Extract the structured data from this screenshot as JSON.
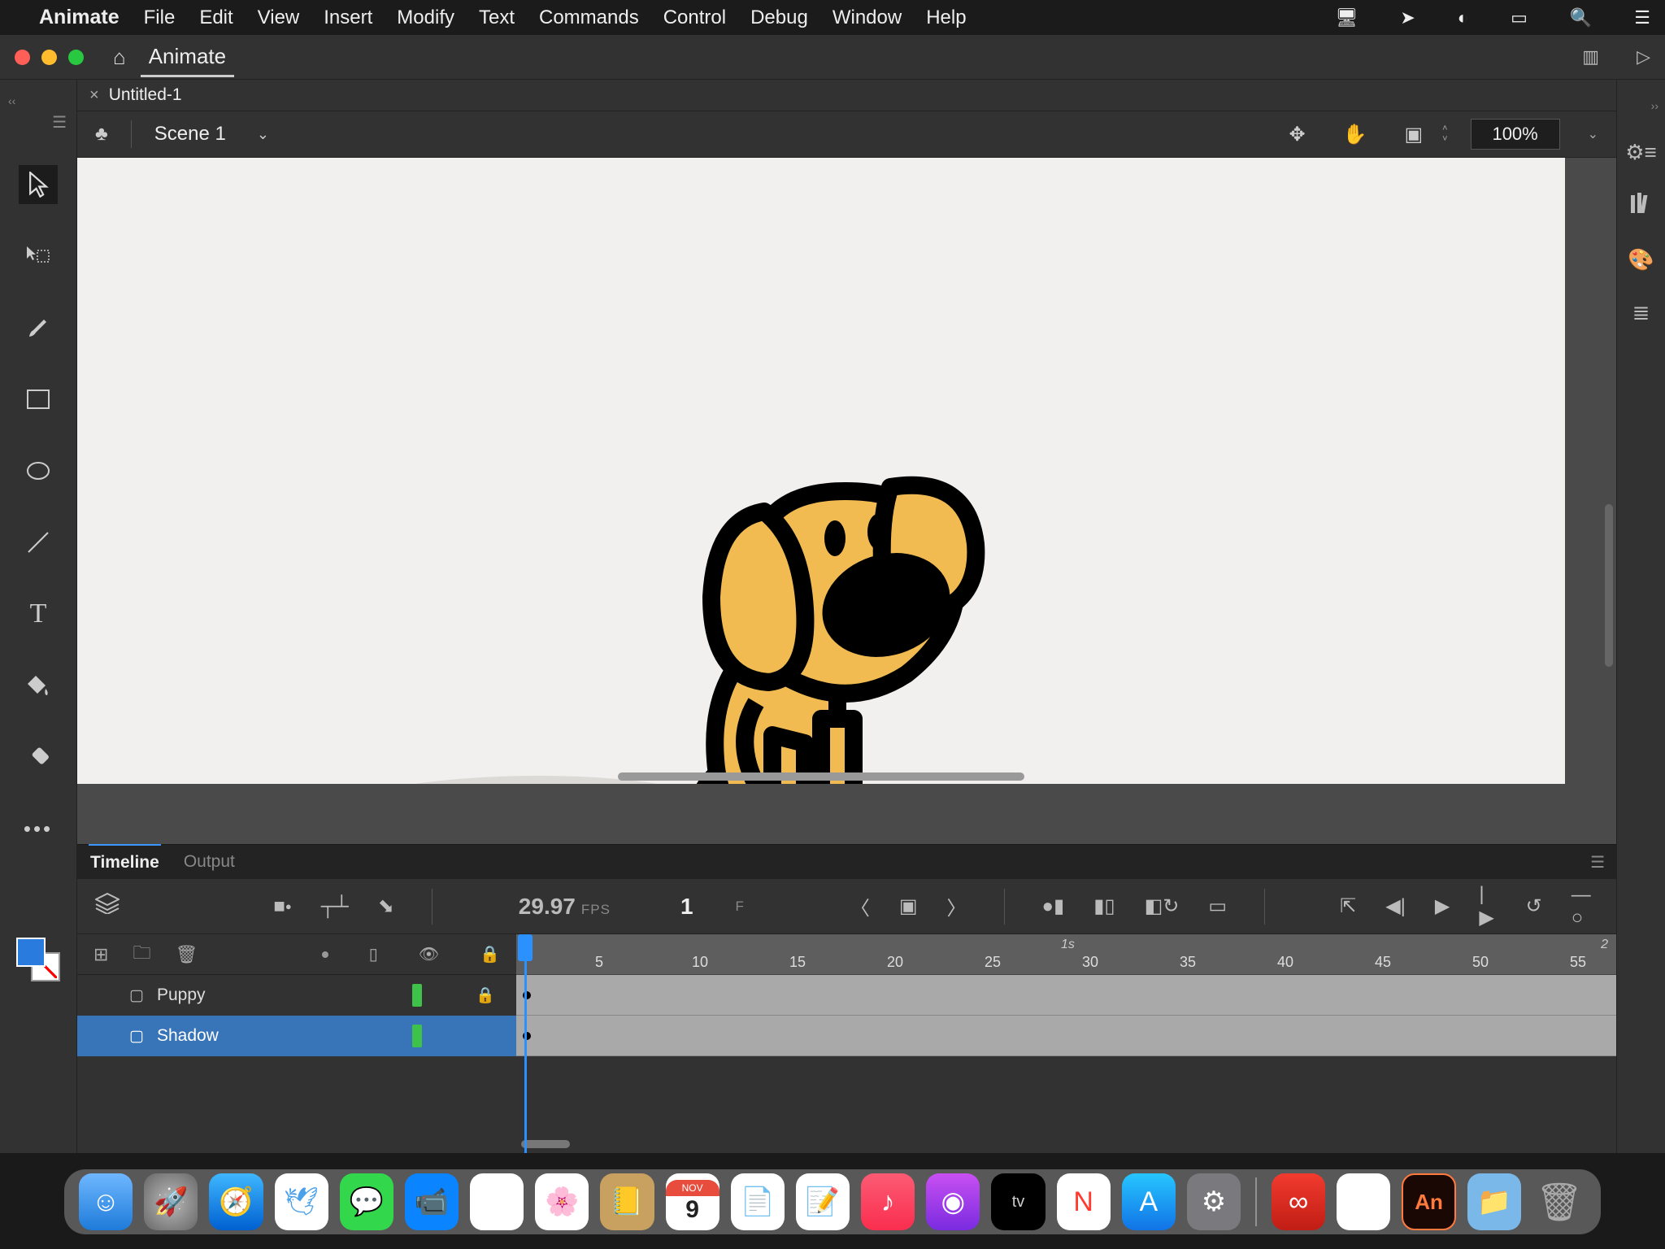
{
  "menubar": {
    "app_name": "Animate",
    "items": [
      "File",
      "Edit",
      "View",
      "Insert",
      "Modify",
      "Text",
      "Commands",
      "Control",
      "Debug",
      "Window",
      "Help"
    ]
  },
  "titlebar": {
    "mode": "Animate"
  },
  "doc_tab": {
    "label": "Untitled-1"
  },
  "editbar": {
    "scene": "Scene 1",
    "zoom": "100%"
  },
  "timeline": {
    "tabs": [
      "Timeline",
      "Output"
    ],
    "active_tab": 0,
    "fps_value": "29.97",
    "fps_unit": "FPS",
    "frame": "1",
    "frame_unit": "F",
    "ruler_time": "1s",
    "ruler_ticks": [
      "5",
      "10",
      "15",
      "20",
      "25",
      "30",
      "35",
      "40",
      "45",
      "50",
      "55"
    ],
    "ruler_end": "2",
    "layers": [
      {
        "name": "Puppy",
        "selected": false,
        "locked": true
      },
      {
        "name": "Shadow",
        "selected": true,
        "locked": false
      }
    ]
  },
  "dock": {
    "apps": [
      "finder",
      "launchpad",
      "safari",
      "mail",
      "messages",
      "maps",
      "photos",
      "contacts",
      "calendar",
      "notes",
      "reminders",
      "music",
      "podcasts",
      "tv",
      "news",
      "appstore",
      "settings"
    ],
    "right_apps": [
      "cc",
      "preview",
      "animate",
      "downloads",
      "trash"
    ],
    "calendar_day": "9",
    "calendar_month": "NOV"
  },
  "colors": {
    "fill": "#2a7bde",
    "dog_body": "#f2bb52",
    "selection": "#3874b8",
    "playhead": "#2a91ff",
    "layer_chip": "#3fc24a"
  }
}
